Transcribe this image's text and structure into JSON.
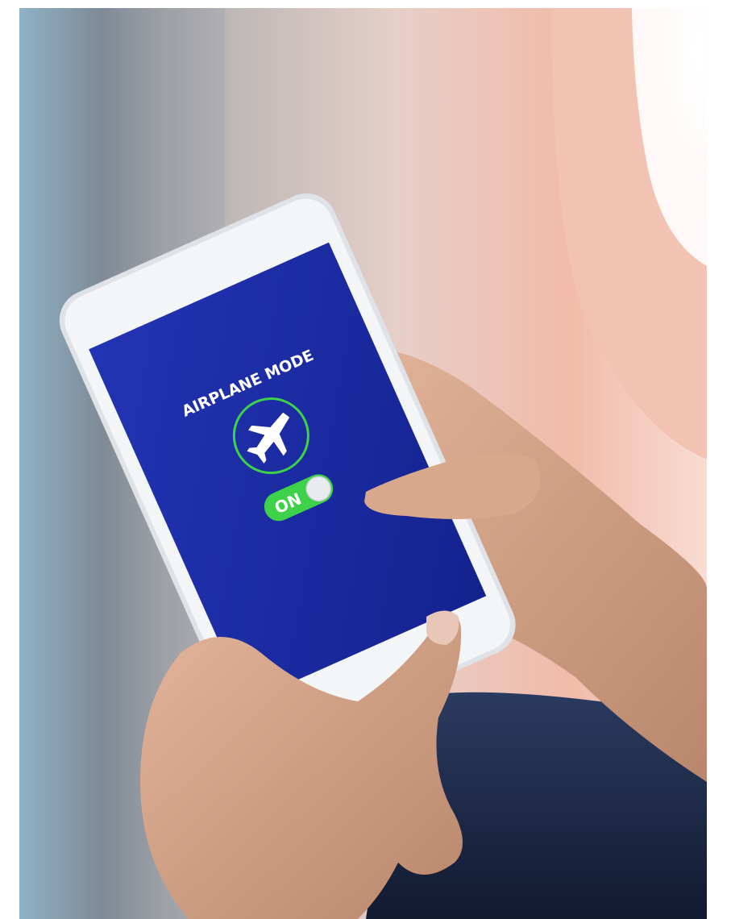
{
  "screen": {
    "title": "AIRPLANE MODE",
    "icon": "airplane-icon",
    "toggle": {
      "label": "ON",
      "state": "on"
    }
  },
  "colors": {
    "screen_blue": "#1f2fa6",
    "accent_green": "#3ed14a",
    "phone_white": "#f4f5f6",
    "window_glow": "#f3b9a8",
    "seat_navy": "#1e2a4a",
    "skin": "#d9a98c"
  }
}
